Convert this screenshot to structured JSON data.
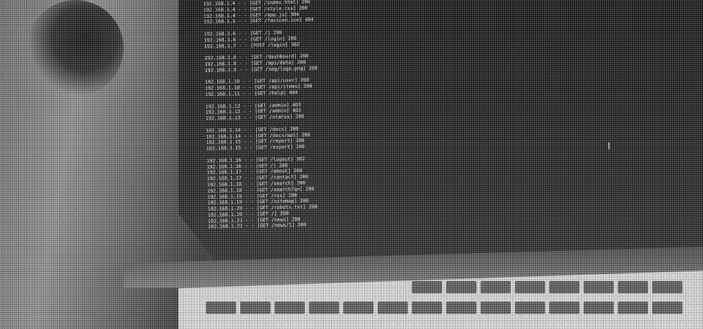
{
  "terminal": {
    "lines": [
      "192.168.1.4 - - [GET /index.html] 200",
      "192.168.1.4 - - [GET /style.css] 200",
      "192.168.1.4 - - [GET /app.js] 304",
      "192.168.1.5 - - [GET /favicon.ico] 404",
      "",
      "192.168.1.6 - - [GET /] 200",
      "192.168.1.6 - - [GET /login] 200",
      "192.168.1.7 - - [POST /login] 302",
      "",
      "192.168.1.8 - - [GET /dashboard] 200",
      "192.168.1.8 - - [GET /api/data] 200",
      "192.168.1.9 - - [GET /img/logo.png] 200",
      "",
      "192.168.1.10 - - [GET /api/user] 200",
      "192.168.1.10 - - [GET /api/items] 200",
      "192.168.1.11 - - [GET /help] 404",
      "",
      "192.168.1.12 - - [GET /admin] 403",
      "192.168.1.12 - - [GET /admin] 403",
      "192.168.1.13 - - [GET /status] 200",
      "",
      "192.168.1.14 - - [GET /docs] 200",
      "192.168.1.14 - - [GET /docs/api] 200",
      "192.168.1.15 - - [GET /report] 200",
      "192.168.1.15 - - [GET /export] 200",
      "",
      "192.168.1.16 - - [GET /logout] 302",
      "192.168.1.16 - - [GET /] 200",
      "192.168.1.17 - - [GET /about] 200",
      "192.168.1.17 - - [GET /contact] 200",
      "192.168.1.18 - - [GET /search] 200",
      "192.168.1.18 - - [GET /search?q=] 200",
      "192.168.1.19 - - [GET /rss] 200",
      "192.168.1.19 - - [GET /sitemap] 200",
      "192.168.1.20 - - [GET /robots.txt] 200",
      "192.168.1.20 - - [GET /] 200",
      "192.168.1.21 - - [GET /news] 200",
      "192.168.1.21 - - [GET /news/1] 200"
    ]
  },
  "icons": {
    "cursor": "I"
  }
}
